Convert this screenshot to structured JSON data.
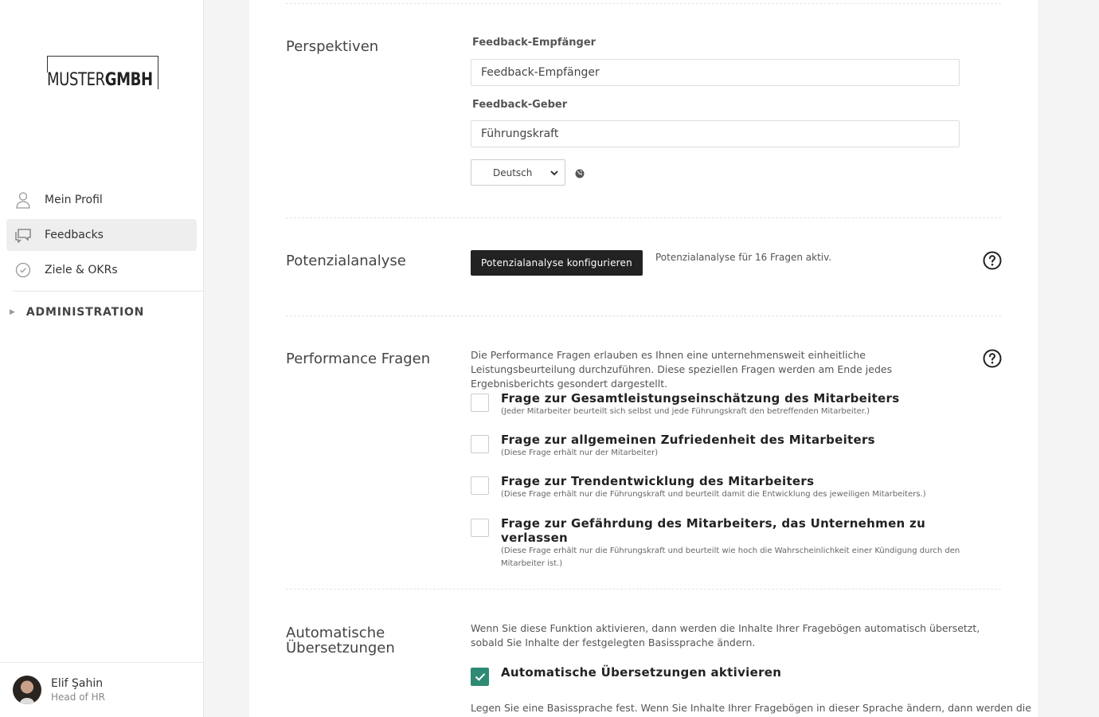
{
  "app": {
    "logo": {
      "part1": "MUSTER",
      "part2": "GMBH"
    }
  },
  "sidebar": {
    "items": [
      {
        "label": "Mein Profil",
        "icon": "user-icon"
      },
      {
        "label": "Feedbacks",
        "icon": "chat-icon",
        "active": true
      },
      {
        "label": "Ziele & OKRs",
        "icon": "check-circle-icon"
      }
    ],
    "admin_label": "ADMINISTRATION"
  },
  "user": {
    "name": "Elif Şahin",
    "role": "Head of HR"
  },
  "perspektiven": {
    "title": "Perspektiven",
    "recipient_label": "Feedback-Empfänger",
    "recipient_value": "Feedback-Empfänger",
    "giver_label": "Feedback-Geber",
    "giver_value": "Führungskraft",
    "language_selected": "Deutsch"
  },
  "potenzial": {
    "title": "Potenzialanalyse",
    "button_label": "Potenzialanalyse konfigurieren",
    "status_text": "Potenzialanalyse für 16 Fragen aktiv."
  },
  "performance": {
    "title": "Performance Fragen",
    "description": "Die Performance Fragen erlauben es Ihnen eine unternehmensweit einheitliche Leistungsbeurteilung durchzuführen. Diese speziellen Fragen werden am Ende jedes Ergebnisberichts gesondert dargestellt.",
    "questions": [
      {
        "title": "Frage zur Gesamtleistungseinschätzung des Mitarbeiters",
        "sub": "(Jeder Mitarbeiter beurteilt sich selbst und jede Führungskraft den betreffenden Mitarbeiter.)",
        "checked": false
      },
      {
        "title": "Frage zur allgemeinen Zufriedenheit des Mitarbeiters",
        "sub": "(Diese Frage erhält nur der Mitarbeiter)",
        "checked": false
      },
      {
        "title": "Frage zur Trendentwicklung des Mitarbeiters",
        "sub": "(Diese Frage erhält nur die Führungskraft und beurteilt damit die Entwicklung des jeweiligen Mitarbeiters.)",
        "checked": false
      },
      {
        "title": "Frage zur Gefährdung des Mitarbeiters, das Unternehmen zu verlassen",
        "sub": "(Diese Frage erhält nur die Führungskraft und beurteilt wie hoch die Wahrscheinlichkeit einer Kündigung durch den Mitarbeiter ist.)",
        "checked": false
      }
    ]
  },
  "translations": {
    "title_line1": "Automatische",
    "title_line2": "Übersetzungen",
    "description": "Wenn Sie diese Funktion aktivieren, dann werden die Inhalte Ihrer Fragebögen automatisch übersetzt, sobald Sie Inhalte der festgelegten Basissprache ändern.",
    "checkbox_label": "Automatische Übersetzungen aktivieren",
    "checked": true,
    "base_language_text": "Legen Sie eine Basissprache fest. Wenn Sie Inhalte Ihrer Fragebögen in dieser Sprache ändern, dann werden die"
  },
  "colors": {
    "accent": "#2f8a73",
    "button_dark": "#222222"
  }
}
